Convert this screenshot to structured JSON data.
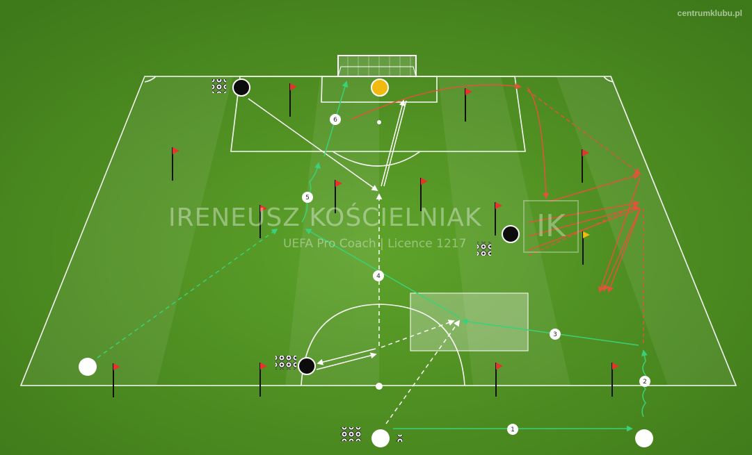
{
  "site_label": "centrumklubu.pl",
  "watermark": {
    "name": "IRENEUSZ KOŚCIELNIAK",
    "subtitle": "UEFA Pro Coach   |   Licence 1217",
    "logo": "IK"
  },
  "sequence_labels": [
    "1",
    "2",
    "3",
    "4",
    "5",
    "6"
  ],
  "colors": {
    "grass": "#4f8f22",
    "lines": "#ffffff",
    "green_run": "#39d27a",
    "red_run": "#e2543a",
    "goalkeeper": "#f2b90f",
    "defender": "#0c0c0c",
    "attacker": "#ffffff",
    "flag": "#e8322b",
    "flag_yellow": "#f2b90f"
  },
  "icons": [
    "soccer-ball-icon",
    "flag-icon",
    "goal-icon"
  ]
}
